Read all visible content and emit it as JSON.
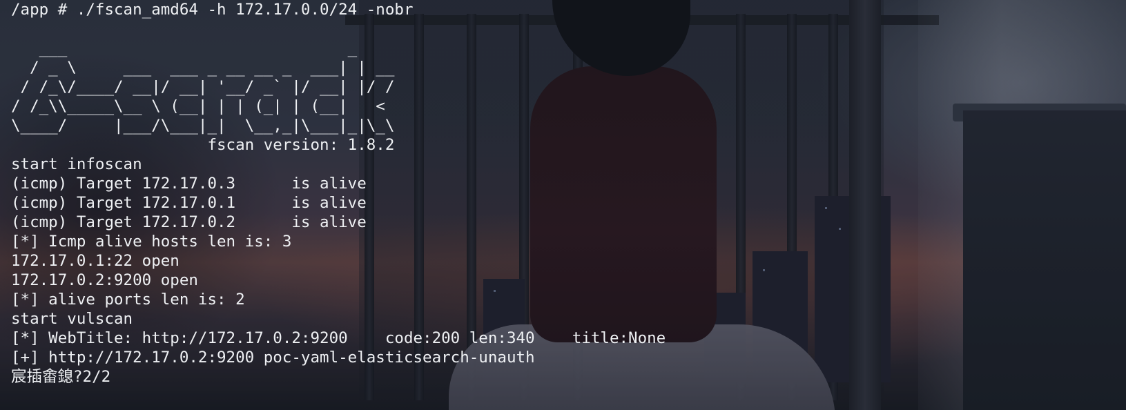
{
  "terminal": {
    "command_line": "/app # ./fscan_amd64 -h 172.17.0.0/24 -nobr",
    "blank_line": "",
    "banner": [
      "   ___                              _    ",
      "  / _ \\     ___  ___ _ __ __ _  ___| | __ ",
      " / /_\\/____/ __|/ __| '__/ _` |/ __| |/ /",
      "/ /_\\\\_____\\__ \\ (__| | | (_| | (__|   <    ",
      "\\____/     |___/\\___|_|  \\__,_|\\___|_|\\_\\   "
    ],
    "version_line": "                     fscan version: 1.8.2",
    "output": [
      "start infoscan",
      "(icmp) Target 172.17.0.3      is alive",
      "(icmp) Target 172.17.0.1      is alive",
      "(icmp) Target 172.17.0.2      is alive",
      "[*] Icmp alive hosts len is: 3",
      "172.17.0.1:22 open",
      "172.17.0.2:9200 open",
      "[*] alive ports len is: 2",
      "start vulscan",
      "[*] WebTitle: http://172.17.0.2:9200    code:200 len:340    title:None",
      "[+] http://172.17.0.2:9200 poc-yaml-elasticsearch-unauth",
      "宸插畬鎴?2/2"
    ]
  }
}
